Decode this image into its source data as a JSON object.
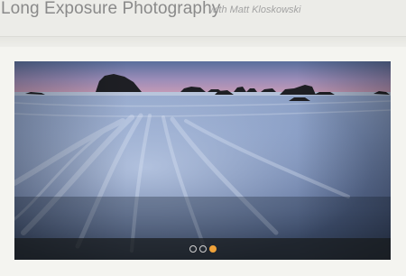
{
  "header": {
    "title": "Long Exposure Photography",
    "byline": "with Matt Kloskowski"
  },
  "slideshow": {
    "slide_count": 3,
    "active_index": 2,
    "colors": {
      "sky_top": "#5a6f9c",
      "sky_horizon": "#c79bb6",
      "water": "#6f86b0",
      "active_dot": "#f0a23a"
    }
  }
}
